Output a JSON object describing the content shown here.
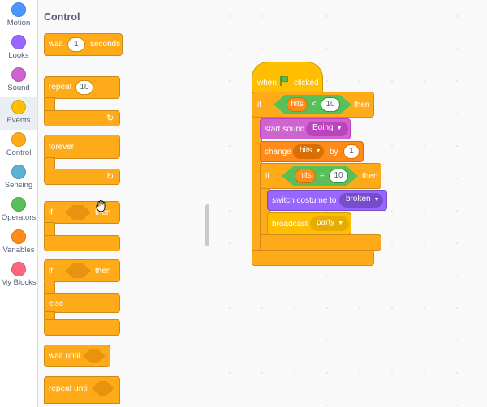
{
  "categories": [
    {
      "label": "Motion",
      "color": "#4c97ff"
    },
    {
      "label": "Looks",
      "color": "#9966ff"
    },
    {
      "label": "Sound",
      "color": "#cf63cf"
    },
    {
      "label": "Events",
      "color": "#ffbf00"
    },
    {
      "label": "Control",
      "color": "#ffab19"
    },
    {
      "label": "Sensing",
      "color": "#5cb1d6"
    },
    {
      "label": "Operators",
      "color": "#59c059"
    },
    {
      "label": "Variables",
      "color": "#ff8c1a"
    },
    {
      "label": "My Blocks",
      "color": "#ff6680"
    }
  ],
  "selected_category": "Events",
  "palette": {
    "title": "Control",
    "wait": {
      "label": "wait",
      "value": "1",
      "suffix": "seconds"
    },
    "repeat": {
      "label": "repeat",
      "value": "10"
    },
    "forever": {
      "label": "forever"
    },
    "if_then": {
      "label": "if",
      "then": "then"
    },
    "if_else": {
      "label": "if",
      "then": "then",
      "else": "else"
    },
    "wait_until": {
      "label": "wait until"
    },
    "repeat_until": {
      "label": "repeat until"
    }
  },
  "script": {
    "hat": {
      "label_when": "when",
      "flag_icon": "green-flag-icon",
      "label_clicked": "clicked"
    },
    "if1": {
      "label": "if",
      "var": "hits",
      "op": "<",
      "value": "10",
      "then": "then"
    },
    "start_sound": {
      "label": "start sound",
      "sound": "Boing"
    },
    "change": {
      "label": "change",
      "var": "hits",
      "by": "by",
      "value": "1"
    },
    "if2": {
      "label": "if",
      "var": "hits",
      "op": "=",
      "value": "10",
      "then": "then"
    },
    "switch_costume": {
      "label": "switch costume to",
      "costume": "broken"
    },
    "broadcast": {
      "label": "broadcast",
      "message": "party"
    }
  },
  "colors": {
    "control": "#ffab19",
    "events": "#ffbf00",
    "operators": "#59c059",
    "variables": "#ff8c1a",
    "sound": "#cf63cf",
    "looks": "#9966ff"
  },
  "cursor_icon": "grab-hand-icon"
}
